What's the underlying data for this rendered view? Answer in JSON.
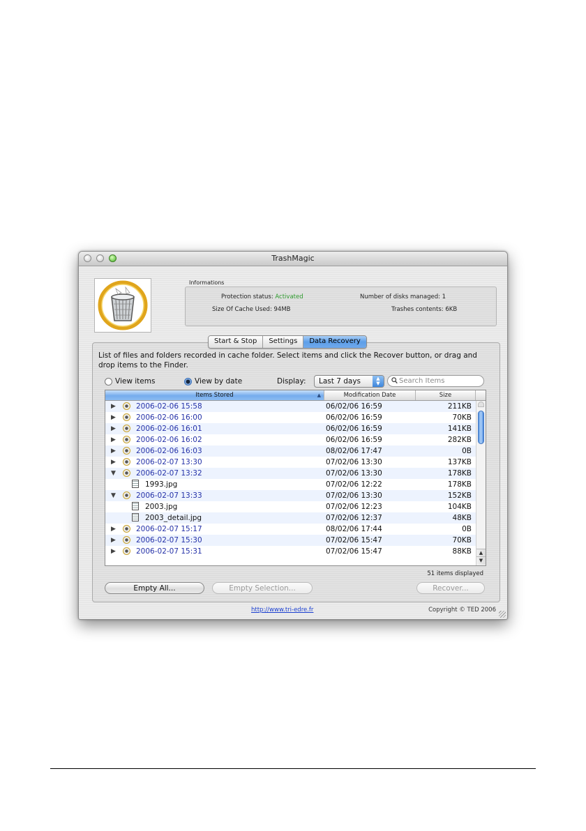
{
  "window": {
    "title": "TrashMagic"
  },
  "informations": {
    "label": "Informations",
    "protection_status_label": "Protection status:",
    "protection_status_value": "Activated",
    "cache_label": "Size Of Cache Used:",
    "cache_value": "94MB",
    "disks_label": "Number of disks managed:",
    "disks_value": "1",
    "trash_label": "Trashes contents:",
    "trash_value": "6KB"
  },
  "tabs": [
    {
      "label": "Start & Stop",
      "active": false
    },
    {
      "label": "Settings",
      "active": false
    },
    {
      "label": "Data Recovery",
      "active": true
    }
  ],
  "recovery": {
    "description": "List of files and folders recorded in cache folder. Select items and click the Recover button, or drag and drop items to the Finder.",
    "radio_view_items": "View items",
    "radio_view_by_date": "View by date",
    "selected_view": "View by date",
    "display_label": "Display:",
    "display_value": "Last 7 days",
    "search_placeholder": "Search Items",
    "search_value": ""
  },
  "table": {
    "columns": [
      "Items Stored",
      "Modification Date",
      "Size"
    ],
    "sorted_column": "Items Stored",
    "rows": [
      {
        "expand": "right",
        "icon": "trash-folder-icon",
        "name": "2006-02-06 15:58",
        "date": "06/02/06 16:59",
        "size": "211KB",
        "child": false
      },
      {
        "expand": "right",
        "icon": "trash-folder-icon",
        "name": "2006-02-06 16:00",
        "date": "06/02/06 16:59",
        "size": "70KB",
        "child": false
      },
      {
        "expand": "right",
        "icon": "trash-folder-icon",
        "name": "2006-02-06 16:01",
        "date": "06/02/06 16:59",
        "size": "141KB",
        "child": false
      },
      {
        "expand": "right",
        "icon": "trash-folder-icon",
        "name": "2006-02-06 16:02",
        "date": "06/02/06 16:59",
        "size": "282KB",
        "child": false
      },
      {
        "expand": "right",
        "icon": "trash-folder-icon",
        "name": "2006-02-06 16:03",
        "date": "08/02/06 17:47",
        "size": "0B",
        "child": false
      },
      {
        "expand": "right",
        "icon": "trash-folder-icon",
        "name": "2006-02-07 13:30",
        "date": "07/02/06 13:30",
        "size": "137KB",
        "child": false
      },
      {
        "expand": "down",
        "icon": "trash-folder-icon",
        "name": "2006-02-07 13:32",
        "date": "07/02/06 13:30",
        "size": "178KB",
        "child": false
      },
      {
        "expand": "",
        "icon": "image-file-icon",
        "name": "1993.jpg",
        "date": "07/02/06 12:22",
        "size": "178KB",
        "child": true
      },
      {
        "expand": "down",
        "icon": "trash-folder-icon",
        "name": "2006-02-07 13:33",
        "date": "07/02/06 13:30",
        "size": "152KB",
        "child": false
      },
      {
        "expand": "",
        "icon": "image-file-icon",
        "name": "2003.jpg",
        "date": "07/02/06 12:23",
        "size": "104KB",
        "child": true
      },
      {
        "expand": "",
        "icon": "image-file-icon",
        "name": "2003_detail.jpg",
        "date": "07/02/06 12:37",
        "size": "48KB",
        "child": true
      },
      {
        "expand": "right",
        "icon": "trash-folder-icon",
        "name": "2006-02-07 15:17",
        "date": "08/02/06 17:44",
        "size": "0B",
        "child": false
      },
      {
        "expand": "right",
        "icon": "trash-folder-icon",
        "name": "2006-02-07 15:30",
        "date": "07/02/06 15:47",
        "size": "70KB",
        "child": false
      },
      {
        "expand": "right",
        "icon": "trash-folder-icon",
        "name": "2006-02-07 15:31",
        "date": "07/02/06 15:47",
        "size": "88KB",
        "child": false
      }
    ],
    "items_displayed": "51 items displayed"
  },
  "buttons": {
    "empty_all": "Empty All...",
    "empty_selection": "Empty Selection...",
    "recover": "Recover..."
  },
  "footer": {
    "link": "http://www.tri-edre.fr",
    "copyright": "Copyright © TED 2006"
  }
}
